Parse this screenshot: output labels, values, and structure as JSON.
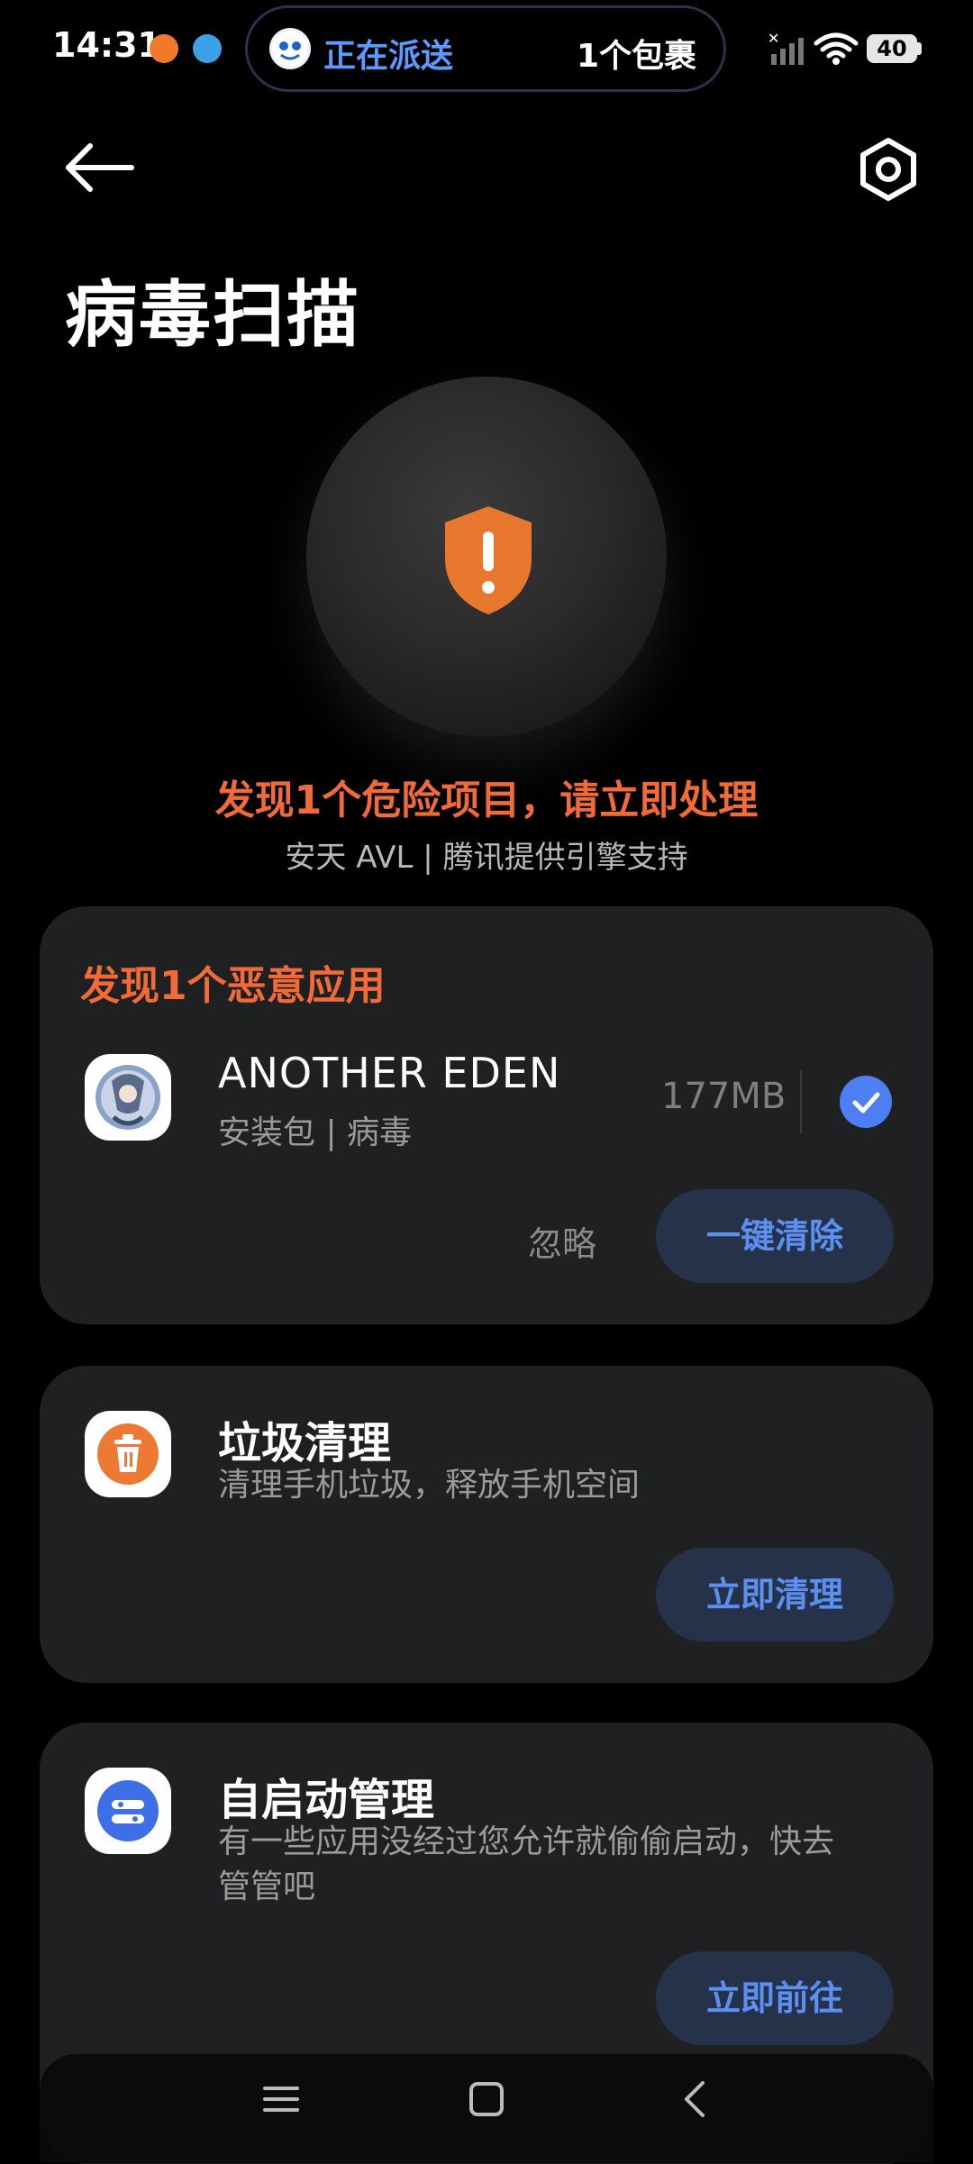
{
  "status_bar": {
    "time": "14:31",
    "island_title": "正在派送",
    "island_count": "1个包裹",
    "battery": "40"
  },
  "header": {
    "title": "病毒扫描"
  },
  "hero": {
    "warning": "发现1个危险项目，请立即处理",
    "engine": "安天 AVL | 腾讯提供引擎支持",
    "colors": {
      "warning": "#f26a37",
      "shield": "#e8772e"
    }
  },
  "malware_card": {
    "title": "发现1个恶意应用",
    "app_name": "ANOTHER EDEN",
    "app_sub": "安装包 | 病毒",
    "size": "177MB",
    "ignore_label": "忽略",
    "clean_label": "一键清除",
    "selected": true
  },
  "junk_card": {
    "title": "垃圾清理",
    "desc": "清理手机垃圾，释放手机空间",
    "action_label": "立即清理"
  },
  "autostart_card": {
    "title": "自启动管理",
    "desc_line1": "有一些应用没经过您允许就偷偷启动，快去",
    "desc_line2": "管管吧",
    "action_label": "立即前往"
  },
  "navbar": {
    "icons": [
      "menu-icon",
      "home-icon",
      "back-icon"
    ]
  }
}
